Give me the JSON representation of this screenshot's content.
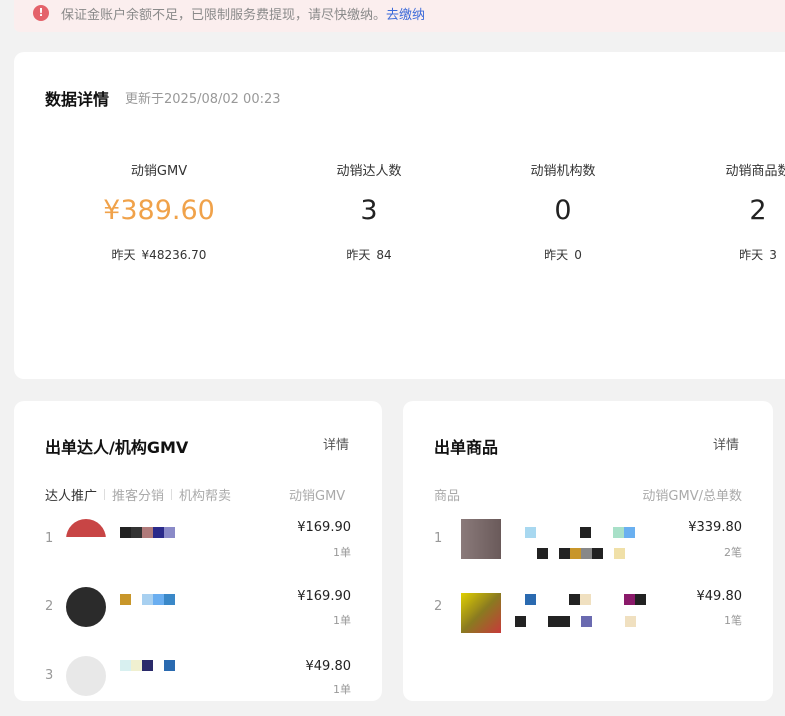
{
  "banner": {
    "message": "保证金账户余额不足，已限制服务费提现，请尽快缴纳。",
    "link": "去缴纳",
    "accent": "#e4626a"
  },
  "summary": {
    "title": "数据详情",
    "updated": "更新于2025/08/02 00:23",
    "metrics": [
      {
        "label": "动销GMV",
        "value": "¥389.60",
        "yesterday_label": "昨天",
        "yesterday_value": "¥48236.70"
      },
      {
        "label": "动销达人数",
        "value": "3",
        "yesterday_label": "昨天",
        "yesterday_value": "84"
      },
      {
        "label": "动销机构数",
        "value": "0",
        "yesterday_label": "昨天",
        "yesterday_value": "0"
      },
      {
        "label": "动销商品数",
        "value": "2",
        "yesterday_label": "昨天",
        "yesterday_value": "3"
      }
    ],
    "gmv_color": "#f0a24a"
  },
  "creators": {
    "title": "出单达人/机构GMV",
    "detail_link": "详情",
    "tabs": [
      "达人推广",
      "推客分销",
      "机构帮卖"
    ],
    "metric_col": "动销GMV",
    "rows": [
      {
        "rank": "1",
        "amount": "¥169.90",
        "count": "1单"
      },
      {
        "rank": "2",
        "amount": "¥169.90",
        "count": "1单"
      },
      {
        "rank": "3",
        "amount": "¥49.80",
        "count": "1单"
      }
    ]
  },
  "products": {
    "title": "出单商品",
    "detail_link": "详情",
    "col_product": "商品",
    "col_metric": "动销GMV/总单数",
    "rows": [
      {
        "rank": "1",
        "amount": "¥339.80",
        "count": "2笔"
      },
      {
        "rank": "2",
        "amount": "¥49.80",
        "count": "1笔"
      }
    ]
  }
}
